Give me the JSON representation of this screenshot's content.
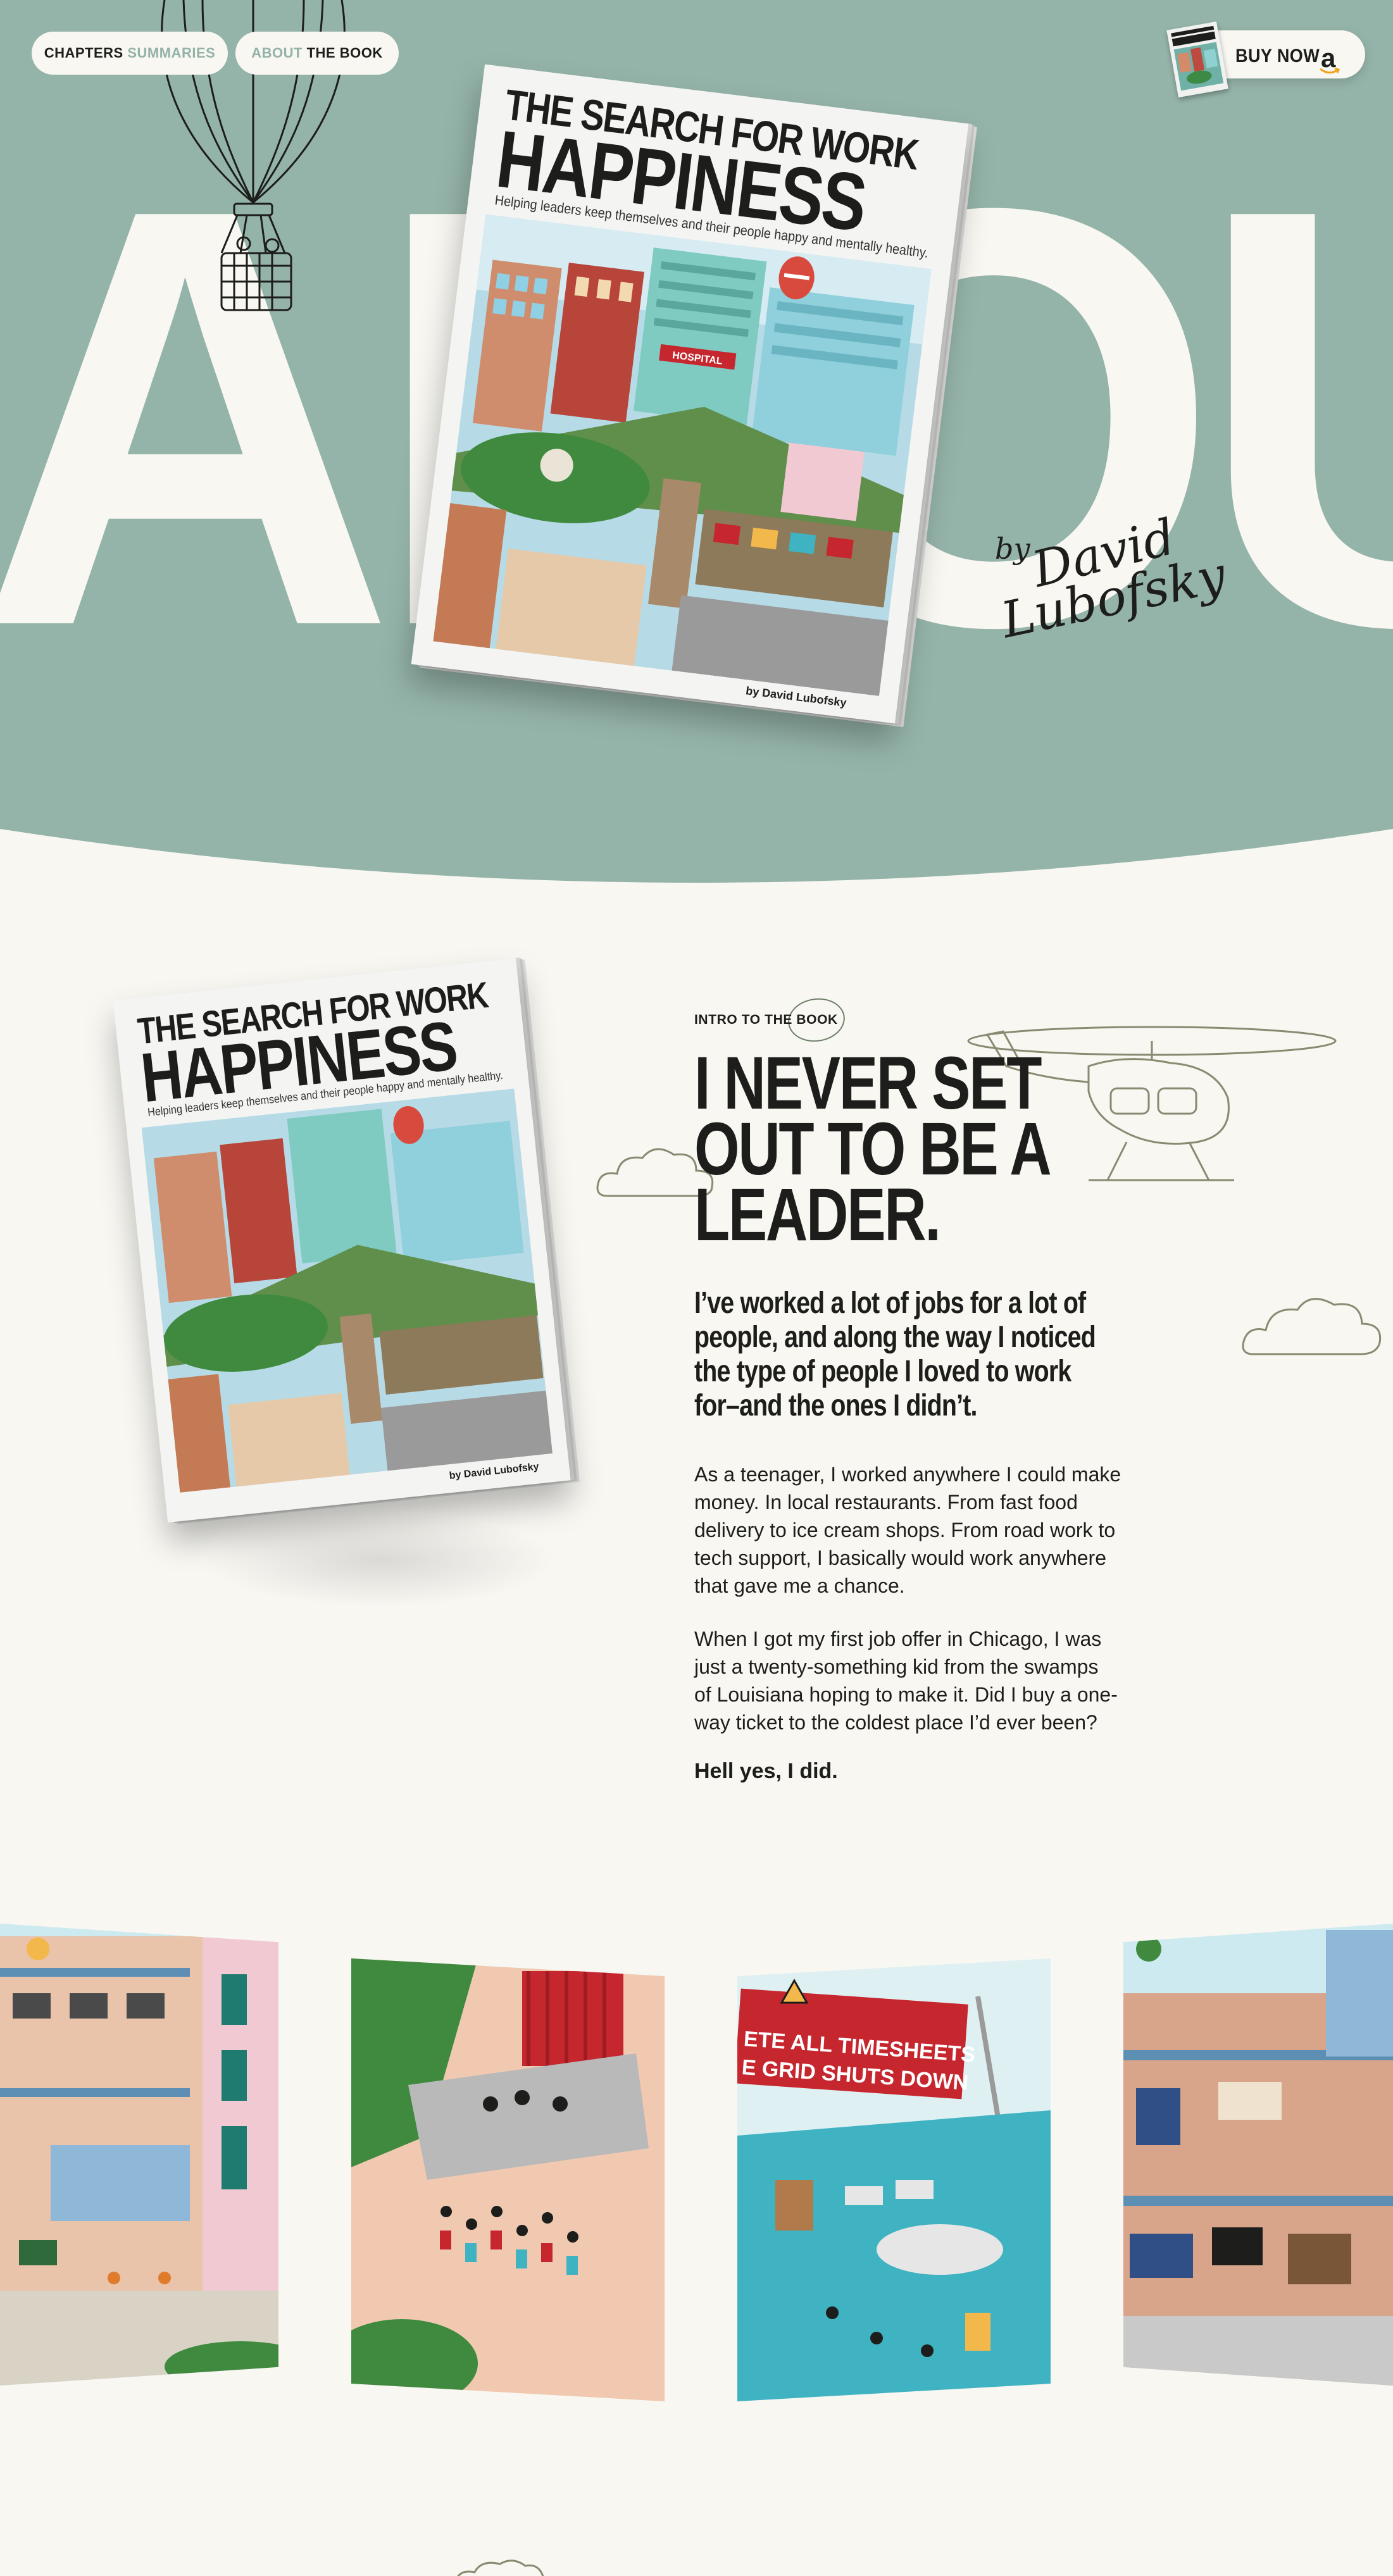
{
  "nav": {
    "chapters_word": "CHAPTERS",
    "summaries_word": "SUMMARIES",
    "about_word": "ABOUT",
    "the_book_word": "THE BOOK"
  },
  "buy": {
    "label": "BUY NOW",
    "store_glyph": "a"
  },
  "hero": {
    "big_word": "ABOUT"
  },
  "signature": {
    "by": "by",
    "first": "David",
    "last": "Lubofsky"
  },
  "book": {
    "title_line1": "THE SEARCH FOR WORK",
    "title_line2": "HAPPINESS",
    "subtitle": "Helping leaders keep themselves and their people happy and mentally healthy.",
    "author": "by David Lubofsky",
    "sign_hospital": "HOSPITAL"
  },
  "intro": {
    "eyebrow": "INTRO TO THE BOOK",
    "headline_lines": [
      "I NEVER SET",
      "OUT TO BE A",
      "LEADER."
    ],
    "lead_lines": [
      "I’ve worked a lot of jobs for a lot of",
      "people, and along the way I noticed",
      "the type of people I loved to work",
      "for–and the ones I didn’t."
    ],
    "p1_lines": [
      "As a teenager, I worked anywhere I could make",
      "money. In local restaurants. From fast food",
      "delivery to ice cream shops. From road work to",
      "tech support, I basically would work anywhere",
      "that gave me a chance."
    ],
    "p2_lines": [
      "When I got my first job offer in Chicago, I was",
      "just a twenty-something kid from the swamps",
      "of Louisiana hoping to make it. Did I buy a one-",
      "way ticket to the coldest place I’d ever been?"
    ],
    "closing": "Hell yes, I did."
  },
  "gallery": {
    "banner_line1": "ETE ALL TIMESHEETS",
    "banner_line2": "E GRID SHUTS DOWN"
  },
  "colors": {
    "sage": "#95b4a9",
    "cream": "#f8f7f2",
    "ink": "#1d1d1b",
    "sketch": "#8a8a72",
    "banner_red": "#c6262e",
    "teal": "#3fb3c1"
  }
}
